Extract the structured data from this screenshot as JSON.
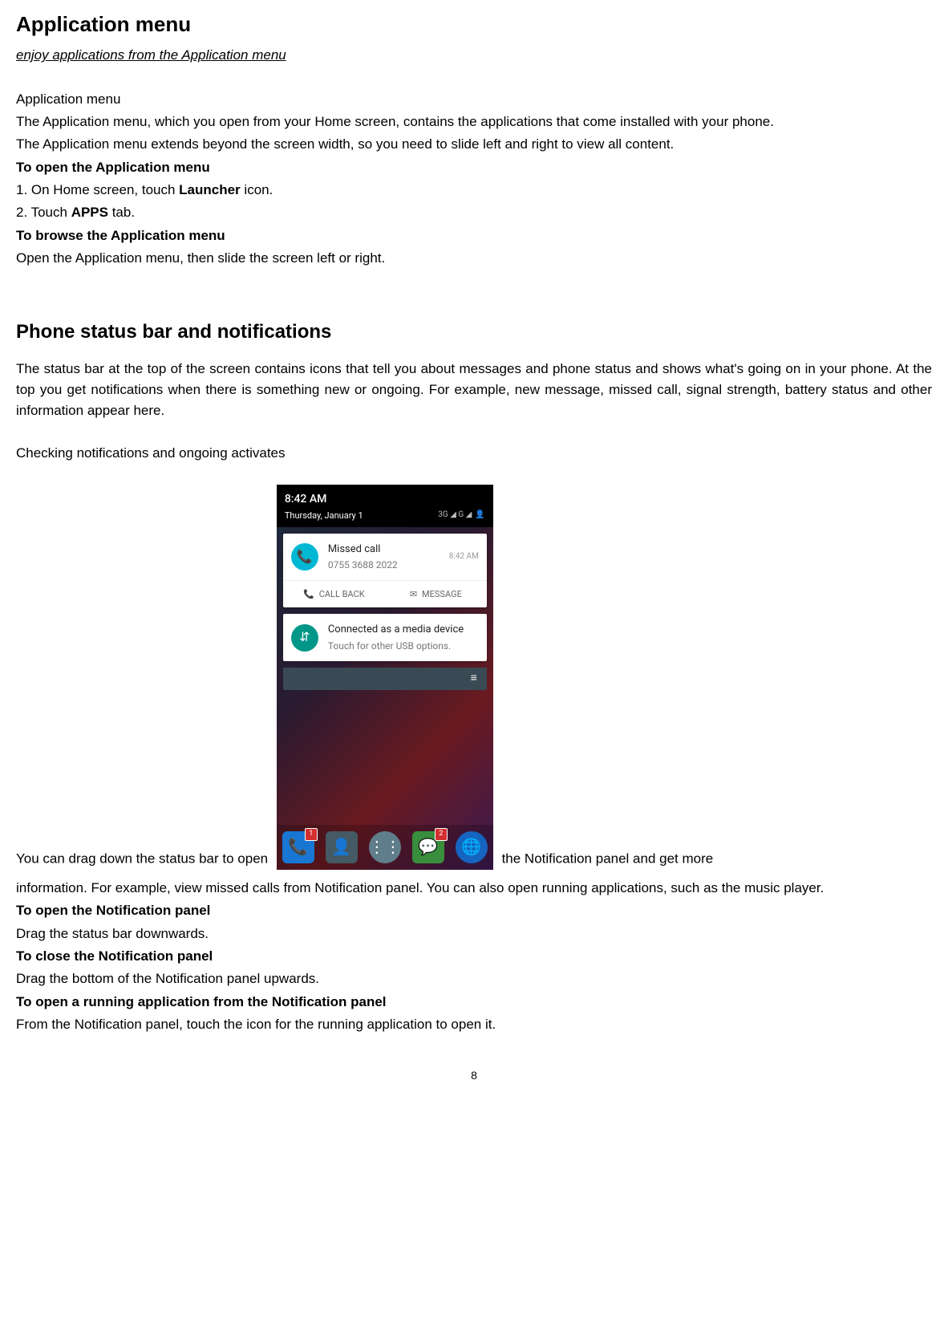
{
  "section1": {
    "heading": "Application menu",
    "subtitle": "enjoy applications from the Application menu",
    "p1": "Application menu",
    "p2": "The Application menu, which you open from your Home screen, contains the applications that come installed with your phone.",
    "p3": "The Application menu extends beyond the screen width, so you need to slide left and right to view all content.",
    "b1": "To open the Application menu",
    "s1a": "1. On Home screen, touch ",
    "s1aBold": "Launcher",
    "s1aTail": " icon.",
    "s2a": "2. Touch ",
    "s2aBold": "APPS",
    "s2aTail": " tab.",
    "b2": "To browse the Application menu",
    "s3": "Open the Application menu, then slide the screen left or right."
  },
  "section2": {
    "heading": "Phone status bar and notifications",
    "p1": "The status bar at the top of the screen contains icons that tell you about messages and phone status and shows what's going on in your phone. At the top you get notifications when there is something new or ongoing. For example, new message, missed call, signal strength, battery status and other information appear here.",
    "p2": "Checking notifications and ongoing activates",
    "wrapBefore": "You can drag down the status bar to open ",
    "wrapAfter": "the Notification panel and get more ",
    "p3": "information. For example, view missed calls from Notification panel. You can also open running applications, such as the music player.",
    "b1": "To open the Notification panel",
    "s1": "Drag the status bar downwards.",
    "b2": "To close the Notification panel",
    "s2": "Drag the bottom of the Notification panel upwards.",
    "b3": "To open a running application from the Notification panel",
    "s3": "From the Notification panel, touch the icon for the running application to open it."
  },
  "screenshot": {
    "time": "8:42 AM",
    "date": "Thursday, January 1",
    "signal": "3G ◢ G ◢",
    "notif1_title": "Missed call",
    "notif1_sub": "0755 3688 2022",
    "notif1_time": "8:42 AM",
    "action1": "CALL BACK",
    "action2": "MESSAGE",
    "notif2_title": "Connected as a media device",
    "notif2_sub": "Touch for other USB options.",
    "badge1": "1",
    "badge2": "2"
  },
  "pageNumber": "8"
}
